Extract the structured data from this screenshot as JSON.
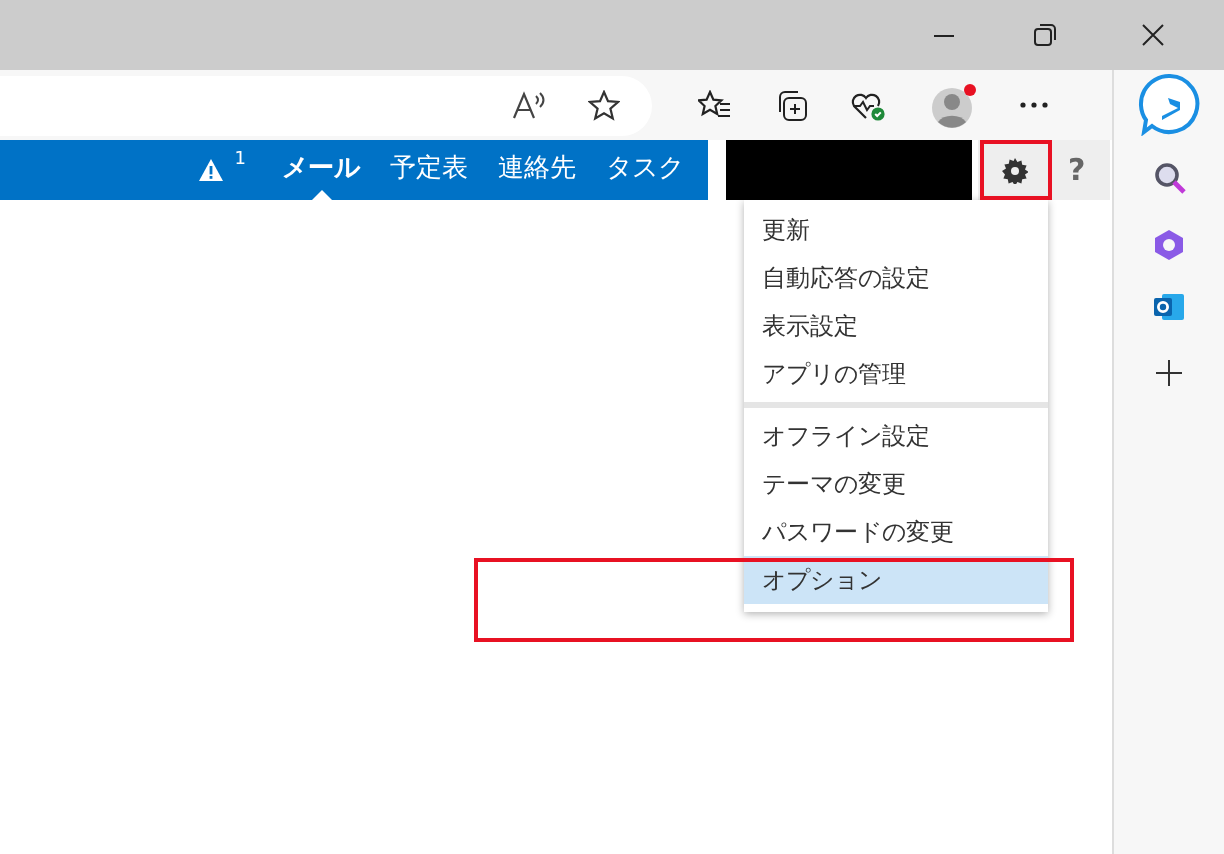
{
  "nav": {
    "alert_count": "1",
    "tabs": [
      {
        "label": "メール",
        "selected": true
      },
      {
        "label": "予定表",
        "selected": false
      },
      {
        "label": "連絡先",
        "selected": false
      },
      {
        "label": "タスク",
        "selected": false
      }
    ],
    "help": "?"
  },
  "settings_menu": {
    "groups": [
      {
        "items": [
          {
            "label": "更新",
            "selected": false
          },
          {
            "label": "自動応答の設定",
            "selected": false
          },
          {
            "label": "表示設定",
            "selected": false
          },
          {
            "label": "アプリの管理",
            "selected": false
          }
        ]
      },
      {
        "items": [
          {
            "label": "オフライン設定",
            "selected": false
          },
          {
            "label": "テーマの変更",
            "selected": false
          },
          {
            "label": "パスワードの変更",
            "selected": false
          },
          {
            "label": "オプション",
            "selected": true
          }
        ]
      }
    ]
  }
}
